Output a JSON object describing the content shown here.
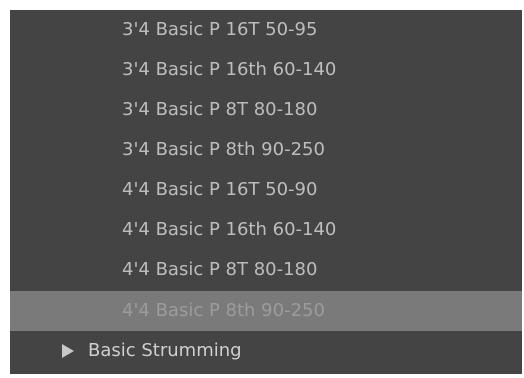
{
  "preset_list": {
    "items": [
      {
        "label": "3'4 Basic P 16T 50-95"
      },
      {
        "label": "3'4 Basic P 16th 60-140"
      },
      {
        "label": "3'4 Basic P 8T 80-180"
      },
      {
        "label": "3'4 Basic P 8th 90-250"
      },
      {
        "label": "4'4 Basic P 16T 50-90"
      },
      {
        "label": "4'4 Basic P 16th 60-140"
      },
      {
        "label": "4'4 Basic P 8T 80-180"
      },
      {
        "label": "4'4 Basic P 8th 90-250"
      }
    ],
    "selected_index": 7,
    "folder": {
      "label": "Basic Strumming",
      "icon": "expand-arrow-icon",
      "expanded": false
    }
  }
}
